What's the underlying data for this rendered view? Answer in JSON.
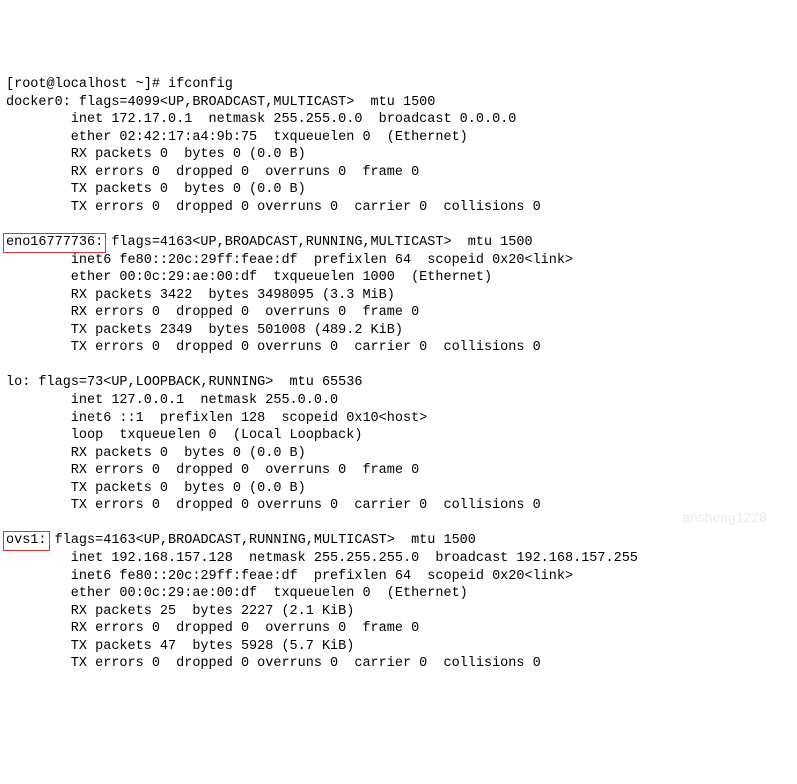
{
  "prompt": "[root@localhost ~]# ",
  "command": "ifconfig",
  "interfaces": {
    "docker0": {
      "name": "docker0:",
      "header": " flags=4099<UP,BROADCAST,MULTICAST>  mtu 1500",
      "inet": "        inet 172.17.0.1  netmask 255.255.0.0  broadcast 0.0.0.0",
      "ether": "        ether 02:42:17:a4:9b:75  txqueuelen 0  (Ethernet)",
      "rxp": "        RX packets 0  bytes 0 (0.0 B)",
      "rxe": "        RX errors 0  dropped 0  overruns 0  frame 0",
      "txp": "        TX packets 0  bytes 0 (0.0 B)",
      "txe": "        TX errors 0  dropped 0 overruns 0  carrier 0  collisions 0"
    },
    "eno": {
      "name": "eno16777736:",
      "header": " flags=4163<UP,BROADCAST,RUNNING,MULTICAST>  mtu 1500",
      "inet6": "        inet6 fe80::20c:29ff:feae:df  prefixlen 64  scopeid 0x20<link>",
      "ether": "        ether 00:0c:29:ae:00:df  txqueuelen 1000  (Ethernet)",
      "rxp": "        RX packets 3422  bytes 3498095 (3.3 MiB)",
      "rxe": "        RX errors 0  dropped 0  overruns 0  frame 0",
      "txp": "        TX packets 2349  bytes 501008 (489.2 KiB)",
      "txe": "        TX errors 0  dropped 0 overruns 0  carrier 0  collisions 0"
    },
    "lo": {
      "name": "lo:",
      "header": " flags=73<UP,LOOPBACK,RUNNING>  mtu 65536",
      "inet": "        inet 127.0.0.1  netmask 255.0.0.0",
      "inet6": "        inet6 ::1  prefixlen 128  scopeid 0x10<host>",
      "loop": "        loop  txqueuelen 0  (Local Loopback)",
      "rxp": "        RX packets 0  bytes 0 (0.0 B)",
      "rxe": "        RX errors 0  dropped 0  overruns 0  frame 0",
      "txp": "        TX packets 0  bytes 0 (0.0 B)",
      "txe": "        TX errors 0  dropped 0 overruns 0  carrier 0  collisions 0"
    },
    "ovs1": {
      "name": "ovs1:",
      "header": " flags=4163<UP,BROADCAST,RUNNING,MULTICAST>  mtu 1500",
      "inet": "        inet 192.168.157.128  netmask 255.255.255.0  broadcast 192.168.157.255",
      "inet6": "        inet6 fe80::20c:29ff:feae:df  prefixlen 64  scopeid 0x20<link>",
      "ether": "        ether 00:0c:29:ae:00:df  txqueuelen 0  (Ethernet)",
      "rxp": "        RX packets 25  bytes 2227 (2.1 KiB)",
      "rxe": "        RX errors 0  dropped 0  overruns 0  frame 0",
      "txp": "        TX packets 47  bytes 5928 (5.7 KiB)",
      "txe": "        TX errors 0  dropped 0 overruns 0  carrier 0  collisions 0"
    }
  },
  "watermark": "ansheng1228"
}
